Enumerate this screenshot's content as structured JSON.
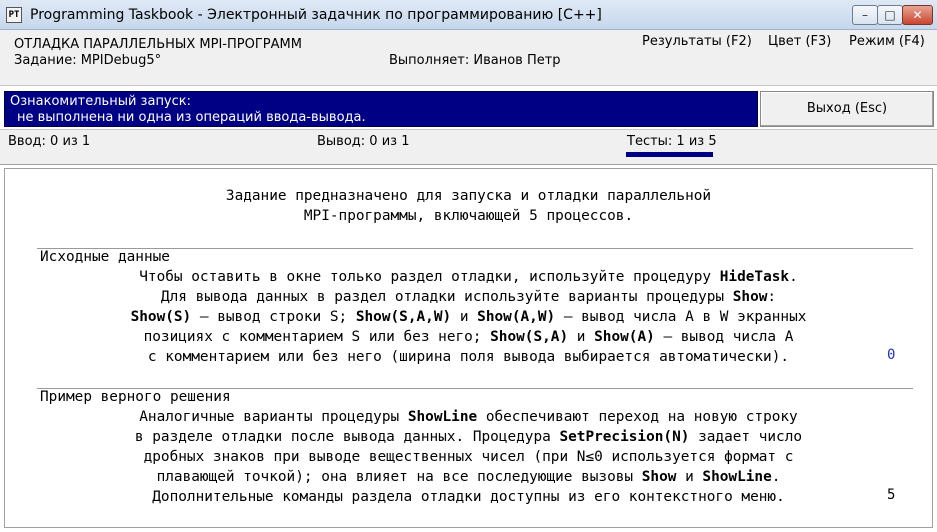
{
  "window": {
    "title": "Programming Taskbook - Электронный задачник по программированию [C++]",
    "app_icon_text": "PT",
    "minimize_glyph": "–",
    "maximize_glyph": "□",
    "close_glyph": "✕"
  },
  "header": {
    "task_title": "ОТЛАДКА ПАРАЛЛЕЛЬНЫХ MPI-ПРОГРАММ",
    "task_id": "Задание: MPIDebug5°",
    "performer": "Выполняет: Иванов Петр",
    "menu": {
      "results": "Результаты (F2)",
      "color": "Цвет (F3)",
      "mode": "Режим (F4)"
    }
  },
  "status": {
    "line1": "Ознакомительный запуск:",
    "line2": "не выполнена ни одна из операций ввода-вывода.",
    "exit_label": "Выход (Esc)"
  },
  "counters": {
    "input": "Ввод: 0 из 1",
    "output": "Вывод: 0 из 1",
    "tests": "Тесты: 1 из 5",
    "tests_progress": 0.2
  },
  "content": {
    "intro_lines": [
      "Задание предназначено для запуска и отладки параллельной",
      "MPI-программы, включающей 5 процессов."
    ],
    "section1_title": "Исходные данные",
    "section1_lines": [
      [
        {
          "t": "Чтобы оставить в окне только раздел отладки, используйте процедуру "
        },
        {
          "t": "HideTask",
          "b": true
        },
        {
          "t": "."
        }
      ],
      [
        {
          "t": "Для вывода данных в раздел отладки используйте варианты процедуры "
        },
        {
          "t": "Show",
          "b": true
        },
        {
          "t": ":"
        }
      ],
      [
        {
          "t": "Show(S)",
          "b": true
        },
        {
          "t": " — вывод строки S; "
        },
        {
          "t": "Show(S,A,W)",
          "b": true
        },
        {
          "t": " и "
        },
        {
          "t": "Show(A,W)",
          "b": true
        },
        {
          "t": " — вывод числа A в W экранных"
        }
      ],
      [
        {
          "t": "позициях с комментарием S или без него; "
        },
        {
          "t": "Show(S,A)",
          "b": true
        },
        {
          "t": " и "
        },
        {
          "t": "Show(A)",
          "b": true
        },
        {
          "t": " — вывод числа A"
        }
      ],
      [
        {
          "t": "с комментарием или без него (ширина поля вывода выбирается автоматически)."
        }
      ]
    ],
    "section1_page": "0",
    "section2_title": "Пример верного решения",
    "section2_lines": [
      [
        {
          "t": "Аналогичные варианты процедуры "
        },
        {
          "t": "ShowLine",
          "b": true
        },
        {
          "t": " обеспечивают переход на новую строку"
        }
      ],
      [
        {
          "t": "в разделе отладки после вывода данных. Процедура "
        },
        {
          "t": "SetPrecision(N)",
          "b": true
        },
        {
          "t": " задает число"
        }
      ],
      [
        {
          "t": "дробных знаков при выводе вещественных чисел (при N≤0 используется формат с"
        }
      ],
      [
        {
          "t": "плавающей точкой); она влияет на все последующие вызовы "
        },
        {
          "t": "Show",
          "b": true
        },
        {
          "t": " и "
        },
        {
          "t": "ShowLine",
          "b": true
        },
        {
          "t": "."
        }
      ],
      [
        {
          "t": "Дополнительные команды раздела отладки доступны из его контекстного меню."
        }
      ]
    ],
    "section2_page": "5"
  }
}
